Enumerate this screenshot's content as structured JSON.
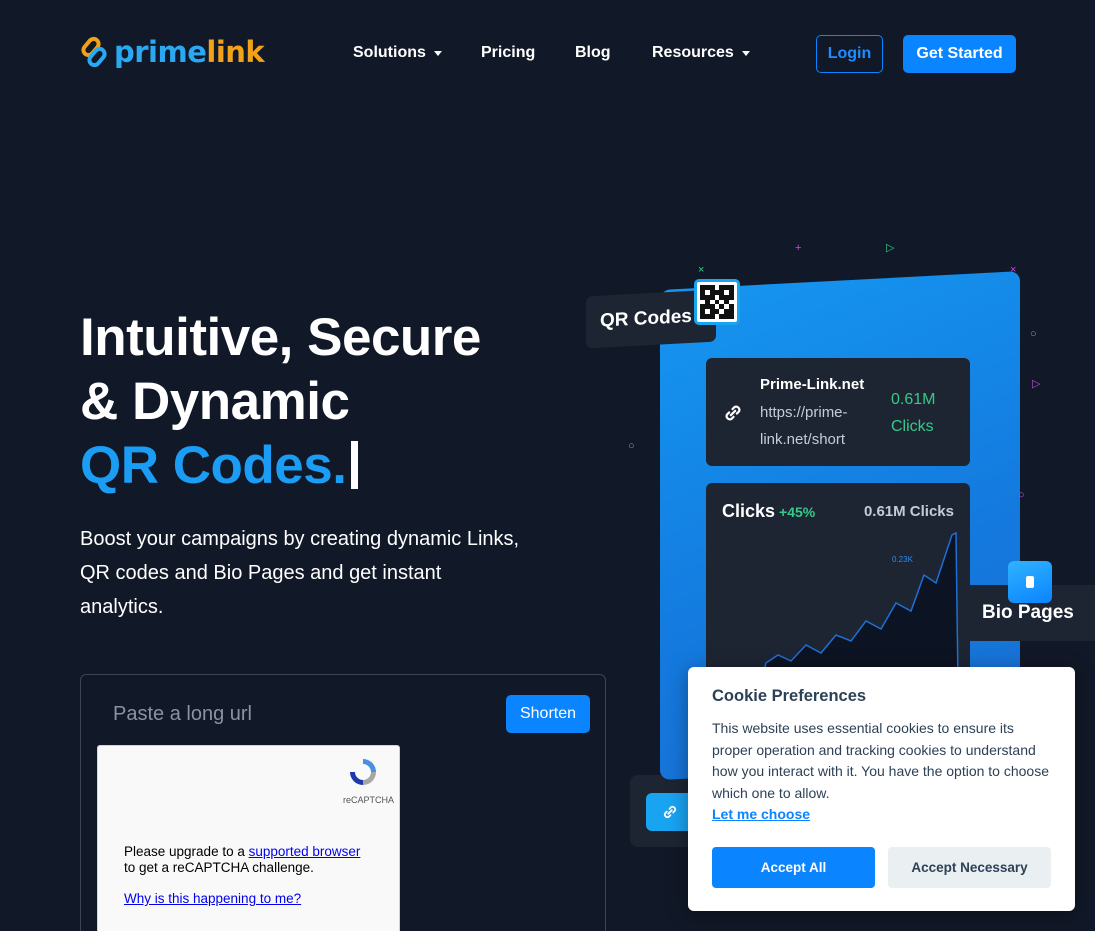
{
  "brand": {
    "name_part1": "prime",
    "name_part2": "link",
    "icon": "chain-link-logo-icon"
  },
  "nav": {
    "items": [
      {
        "label": "Solutions",
        "dropdown": true
      },
      {
        "label": "Pricing",
        "dropdown": false
      },
      {
        "label": "Blog",
        "dropdown": false
      },
      {
        "label": "Resources",
        "dropdown": true
      }
    ],
    "login_label": "Login",
    "get_started_label": "Get Started"
  },
  "hero": {
    "title_line1": "Intuitive, Secure",
    "title_line2": "& Dynamic",
    "title_accent": "QR Codes.",
    "subtitle": "Boost your campaigns by creating dynamic Links, QR codes and Bio Pages and get instant analytics."
  },
  "shortener": {
    "placeholder": "Paste a long url",
    "button_label": "Shorten"
  },
  "recaptcha": {
    "brand_label": "reCAPTCHA",
    "message_prefix": "Please upgrade to a ",
    "message_link": "supported browser",
    "message_suffix": "to get a reCAPTCHA challenge.",
    "why_link": "Why is this happening to me?"
  },
  "illustration": {
    "qr_tag": "QR Codes",
    "link_card": {
      "name": "Prime-Link.net",
      "url": "https://prime-link.net/short",
      "clicks_value": "0.61M",
      "clicks_label": "Clicks"
    },
    "chart_card": {
      "title": "Clicks",
      "change": "+45%",
      "total": "0.61M Clicks",
      "peak_label": "0.23K"
    },
    "bio_tag": "Bio Pages"
  },
  "cookie": {
    "title": "Cookie Preferences",
    "text": "This website uses essential cookies to ensure its proper operation and tracking cookies to understand how you interact with it. You have the option to choose which one to allow.",
    "choose_link": "Let me choose",
    "accept_all": "Accept All",
    "accept_necessary": "Accept Necessary"
  },
  "colors": {
    "background": "#111827",
    "accent": "#0a84ff",
    "brand_blue": "#2ba8f2",
    "brand_orange": "#f2a11a",
    "positive": "#35c98a"
  }
}
